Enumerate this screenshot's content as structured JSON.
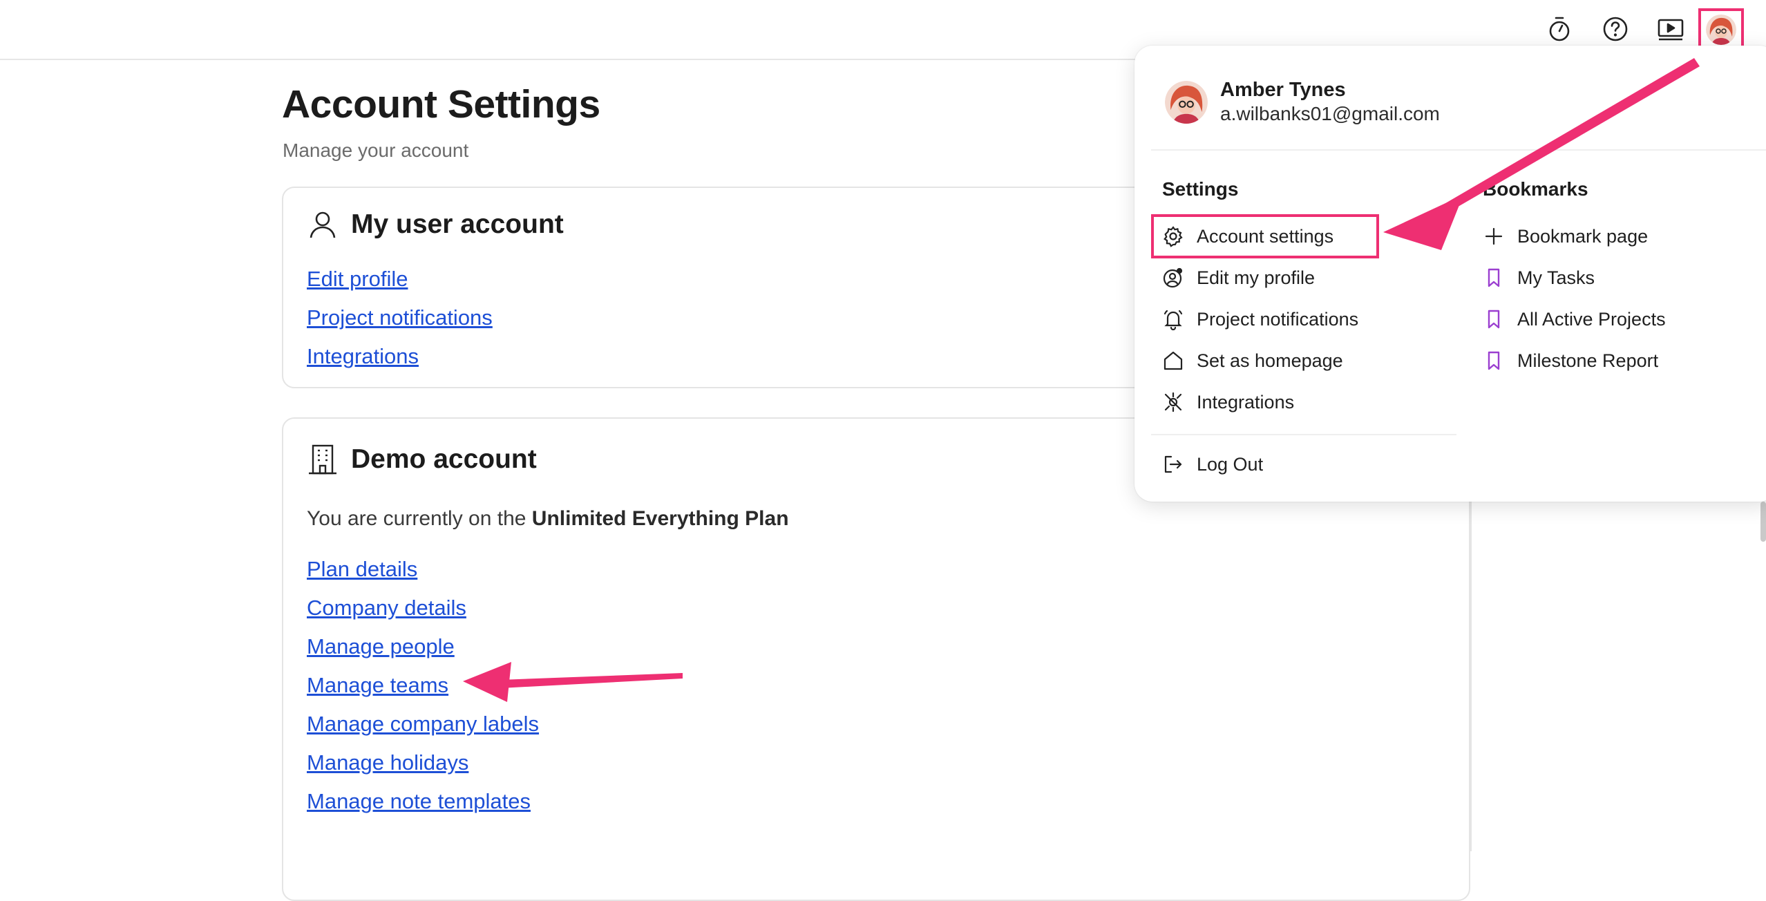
{
  "header": {
    "icons": [
      "stopwatch-icon",
      "help-icon",
      "video-tutorial-icon",
      "user-avatar"
    ]
  },
  "page": {
    "title": "Account Settings",
    "subtitle": "Manage your account"
  },
  "user_card": {
    "title": "My user account",
    "links": [
      "Edit profile",
      "Project notifications",
      "Integrations"
    ]
  },
  "demo_card": {
    "title": "Demo account",
    "plan_prefix": "You are currently on the ",
    "plan_name": "Unlimited Everything Plan",
    "links": [
      "Plan details",
      "Company details",
      "Manage people",
      "Manage teams",
      "Manage company labels",
      "Manage holidays",
      "Manage note templates"
    ]
  },
  "dropdown": {
    "user_name": "Amber Tynes",
    "user_email": "a.wilbanks01@gmail.com",
    "settings_heading": "Settings",
    "settings_items": [
      {
        "label": "Account settings",
        "icon": "gear-icon"
      },
      {
        "label": "Edit my profile",
        "icon": "profile-icon"
      },
      {
        "label": "Project notifications",
        "icon": "bell-icon"
      },
      {
        "label": "Set as homepage",
        "icon": "home-icon"
      },
      {
        "label": "Integrations",
        "icon": "plug-icon"
      }
    ],
    "logout_label": "Log Out",
    "bookmarks_heading": "Bookmarks",
    "bookmark_items": [
      {
        "label": "Bookmark page",
        "icon": "plus-icon"
      },
      {
        "label": "My Tasks",
        "icon": "bookmark-icon"
      },
      {
        "label": "All Active Projects",
        "icon": "bookmark-icon"
      },
      {
        "label": "Milestone Report",
        "icon": "bookmark-icon"
      }
    ]
  },
  "colors": {
    "link": "#1d4fd6",
    "annotation": "#ee2f72",
    "bookmark": "#9b3fd0"
  }
}
